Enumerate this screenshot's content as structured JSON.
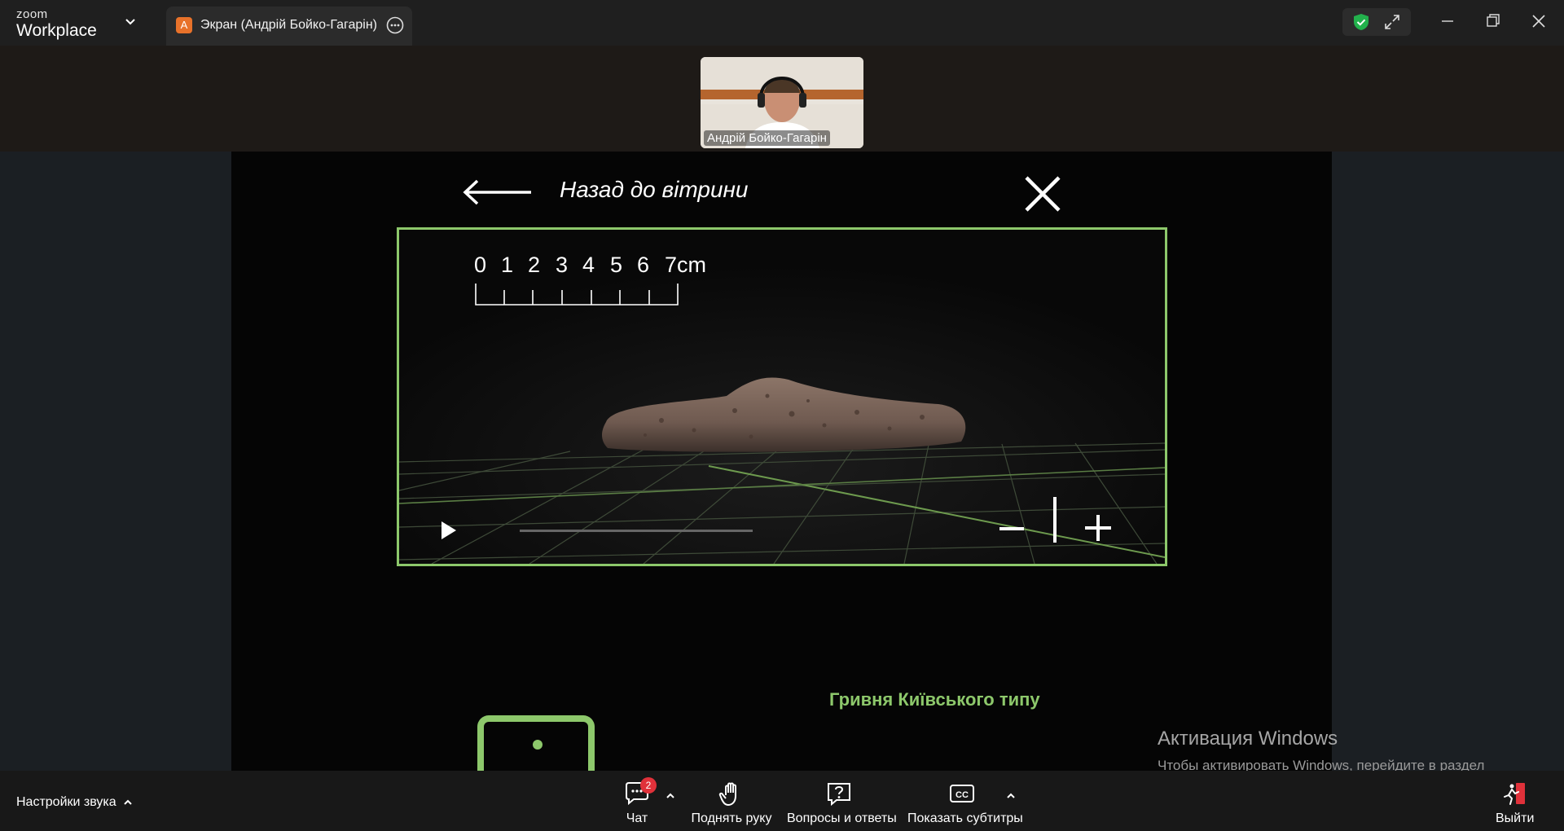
{
  "titlebar": {
    "brand_top": "zoom",
    "brand_bottom": "Workplace",
    "tab": {
      "avatar_letter": "A",
      "title": "Экран (Андрій Бойко-Гагарін)"
    },
    "icons": {
      "brand_menu": "chevron-down-icon",
      "tab_more": "more-options-icon",
      "security": "shield-check-icon",
      "fullscreen": "expand-icon",
      "minimize": "minimize-icon",
      "restore": "restore-icon",
      "close": "close-icon"
    },
    "colors": {
      "avatar": "#e8722a",
      "security_shield": "#22b14c"
    }
  },
  "participant": {
    "name": "Андрій Бойко-Гагарін"
  },
  "shared_screen": {
    "back_label": "Назад до вітрини",
    "ruler_labels": [
      "0",
      "1",
      "2",
      "3",
      "4",
      "5",
      "6",
      "7cm"
    ],
    "product_title": "Гривня Київського типу",
    "accent_color": "#8dc86b",
    "icons": {
      "back": "arrow-left-icon",
      "close": "close-icon",
      "play": "play-icon",
      "zoom_out": "minus-icon",
      "zoom_in": "plus-icon",
      "device": "phone-rotate-icon"
    }
  },
  "windows_activation": {
    "title": "Активация Windows",
    "message": "Чтобы активировать Windows, перейдите в раздел \"Параметры\"."
  },
  "toolbar": {
    "audio_settings": "Настройки звука",
    "chat": {
      "label": "Чат",
      "badge": "2"
    },
    "raise_hand": "Поднять руку",
    "qa": "Вопросы и ответы",
    "captions": "Показать субтитры",
    "leave": "Выйти",
    "colors": {
      "badge": "#e0313a",
      "leave": "#e0313a"
    }
  }
}
